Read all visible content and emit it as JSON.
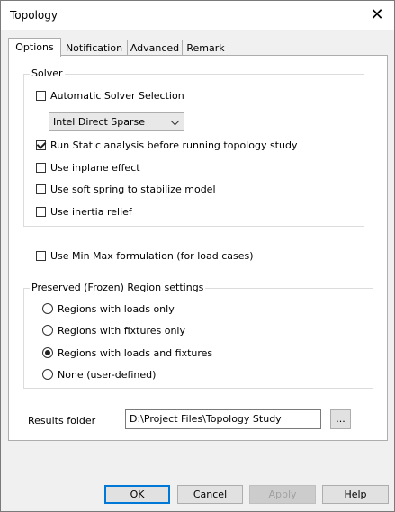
{
  "window": {
    "title": "Topology"
  },
  "tabs": [
    {
      "label": "Options",
      "active": true
    },
    {
      "label": "Notification",
      "active": false
    },
    {
      "label": "Advanced",
      "active": false
    },
    {
      "label": "Remark",
      "active": false
    }
  ],
  "solver": {
    "group_label": "Solver",
    "auto_solver_label": "Automatic Solver Selection",
    "auto_solver_checked": false,
    "solver_select_value": "Intel Direct Sparse",
    "run_static_label": "Run Static analysis before running topology study",
    "run_static_checked": true,
    "inplane_label": "Use inplane effect",
    "inplane_checked": false,
    "soft_spring_label": "Use soft spring to stabilize model",
    "soft_spring_checked": false,
    "inertia_label": "Use inertia relief",
    "inertia_checked": false
  },
  "minmax": {
    "label": "Use Min Max formulation (for load cases)",
    "checked": false
  },
  "frozen": {
    "group_label": "Preserved (Frozen) Region settings",
    "options": [
      {
        "label": "Regions with loads only",
        "selected": false
      },
      {
        "label": "Regions with fixtures only",
        "selected": false
      },
      {
        "label": "Regions with loads and fixtures",
        "selected": true
      },
      {
        "label": "None (user-defined)",
        "selected": false
      }
    ]
  },
  "results": {
    "label": "Results folder",
    "path": "D:\\Project Files\\Topology Study",
    "browse_label": "..."
  },
  "buttons": {
    "ok": "OK",
    "cancel": "Cancel",
    "apply": "Apply",
    "help": "Help"
  },
  "colors": {
    "accent": "#0078d7",
    "dialog_bg": "#f0f0f0",
    "page_bg": "#ffffff"
  }
}
